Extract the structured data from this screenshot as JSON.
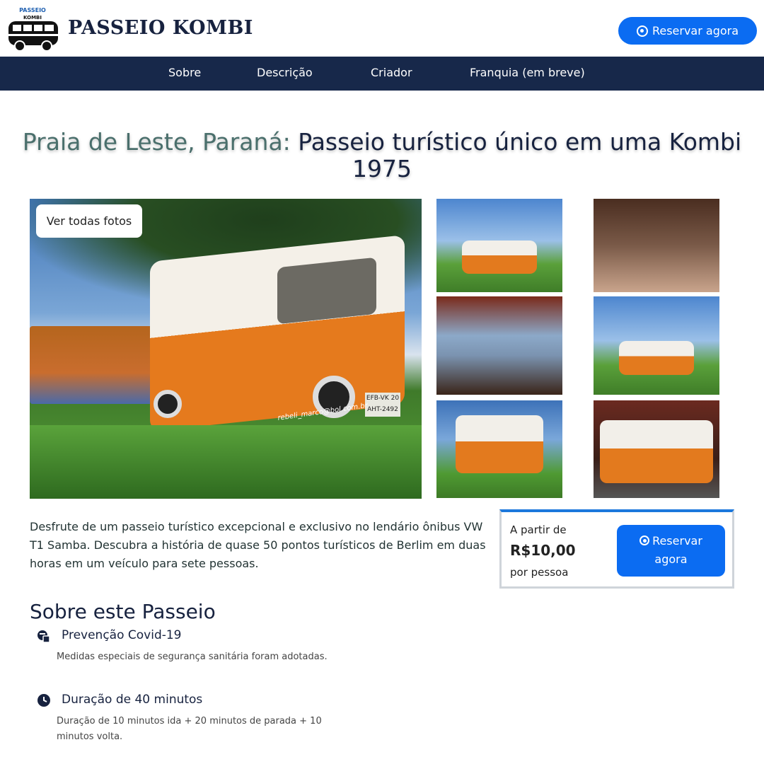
{
  "header": {
    "logo_lines": [
      "PASSEIO",
      "KOMBI"
    ],
    "brand": "PASSEIO KOMBI",
    "cta_label": "Reservar agora",
    "cta_icon": "whatsapp-icon"
  },
  "nav": {
    "items": [
      {
        "label": "Sobre"
      },
      {
        "label": "Descrição"
      },
      {
        "label": "Criador"
      },
      {
        "label": "Franquia (em breve)"
      }
    ]
  },
  "hero": {
    "title_highlight": "Praia de Leste, Paraná:",
    "title_rest": " Passeio turístico único em uma Kombi 1975"
  },
  "gallery": {
    "view_all_label": "Ver todas fotos",
    "main_photo_watermark": "rebeli_marco@bol.com.br",
    "plates": [
      "EFB-VK 20",
      "AHT-2492"
    ]
  },
  "description": "Desfrute de um passeio turístico excepcional e exclusivo no lendário ônibus VW T1 Samba. Descubra a história de quase 50 pontos turísticos de Berlim em duas horas em um veículo para sete pessoas.",
  "pricing": {
    "from_label": "A partir de",
    "price": "R$10,00",
    "per_label": "por pessoa",
    "cta_line1": "Reservar",
    "cta_line2": "agora",
    "accent": "#0b6cf2"
  },
  "about": {
    "title": "Sobre este Passeio",
    "features": [
      {
        "icon": "covid-prevention-icon",
        "title": "Prevenção Covid-19",
        "text": "Medidas especiais de segurança sanitária foram adotadas."
      },
      {
        "icon": "clock-icon",
        "title": "Duração de 40 minutos",
        "text": "Duração de 10 minutos ida + 20 minutos de parada + 10 minutos volta."
      }
    ]
  },
  "colors": {
    "nav_bg": "#17284a",
    "brand_text": "#17223f",
    "title_highlight": "#4a6f6c",
    "button": "#0b6cf2",
    "van_orange": "#e37a1e"
  }
}
